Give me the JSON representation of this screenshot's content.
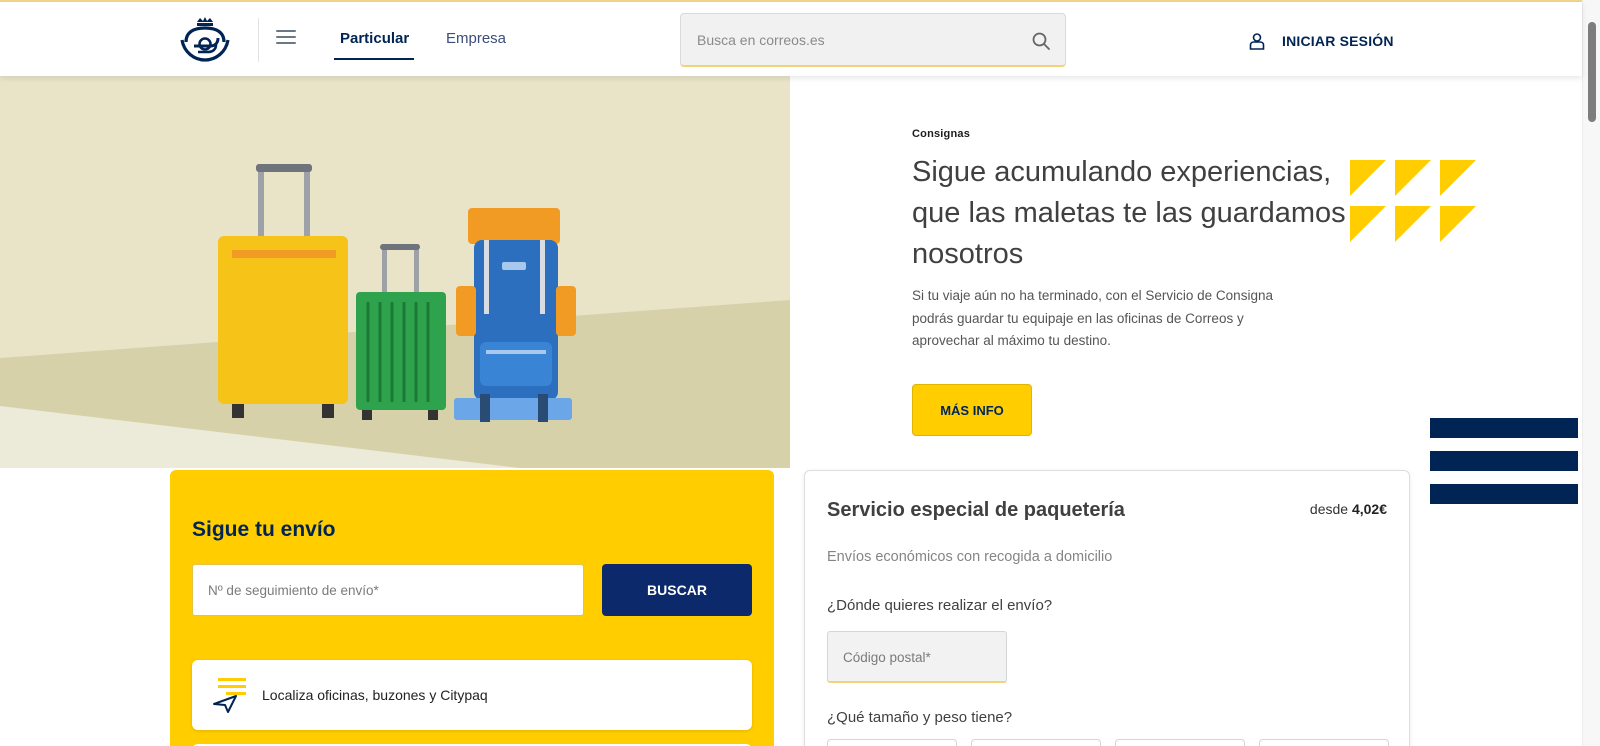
{
  "header": {
    "tabs": [
      {
        "label": "Particular",
        "active": true
      },
      {
        "label": "Empresa",
        "active": false
      }
    ],
    "search": {
      "placeholder": "Busca en correos.es"
    },
    "login_label": "INICIAR SESIÓN"
  },
  "hero": {
    "eyebrow": "Consignas",
    "title": "Sigue acumulando experiencias, que las maletas te las guardamos nosotros",
    "description": "Si tu viaje aún no ha terminado, con el Servicio de Consigna podrás guardar tu equipaje en las oficinas de Correos y aprovechar al máximo tu destino.",
    "cta_label": "MÁS INFO"
  },
  "tracking": {
    "title": "Sigue tu envío",
    "input_placeholder": "Nº de seguimiento de envío*",
    "button_label": "BUSCAR",
    "locator_label": "Localiza oficinas, buzones y Citypaq"
  },
  "package": {
    "title": "Servicio especial de paquetería",
    "price_prefix": "desde",
    "price_value": "4,02€",
    "subtitle": "Envíos económicos con recogida a domicilio",
    "question_where": "¿Dónde quieres realizar el envío?",
    "postal_placeholder": "Código postal*",
    "question_size": "¿Qué tamaño y peso tiene?"
  },
  "colors": {
    "brand_yellow": "#ffcd00",
    "brand_navy": "#002453",
    "button_navy": "#0c2a6b"
  },
  "icons": [
    "correos-logo-icon",
    "menu-icon",
    "search-icon",
    "user-icon",
    "location-arrow-icon"
  ]
}
